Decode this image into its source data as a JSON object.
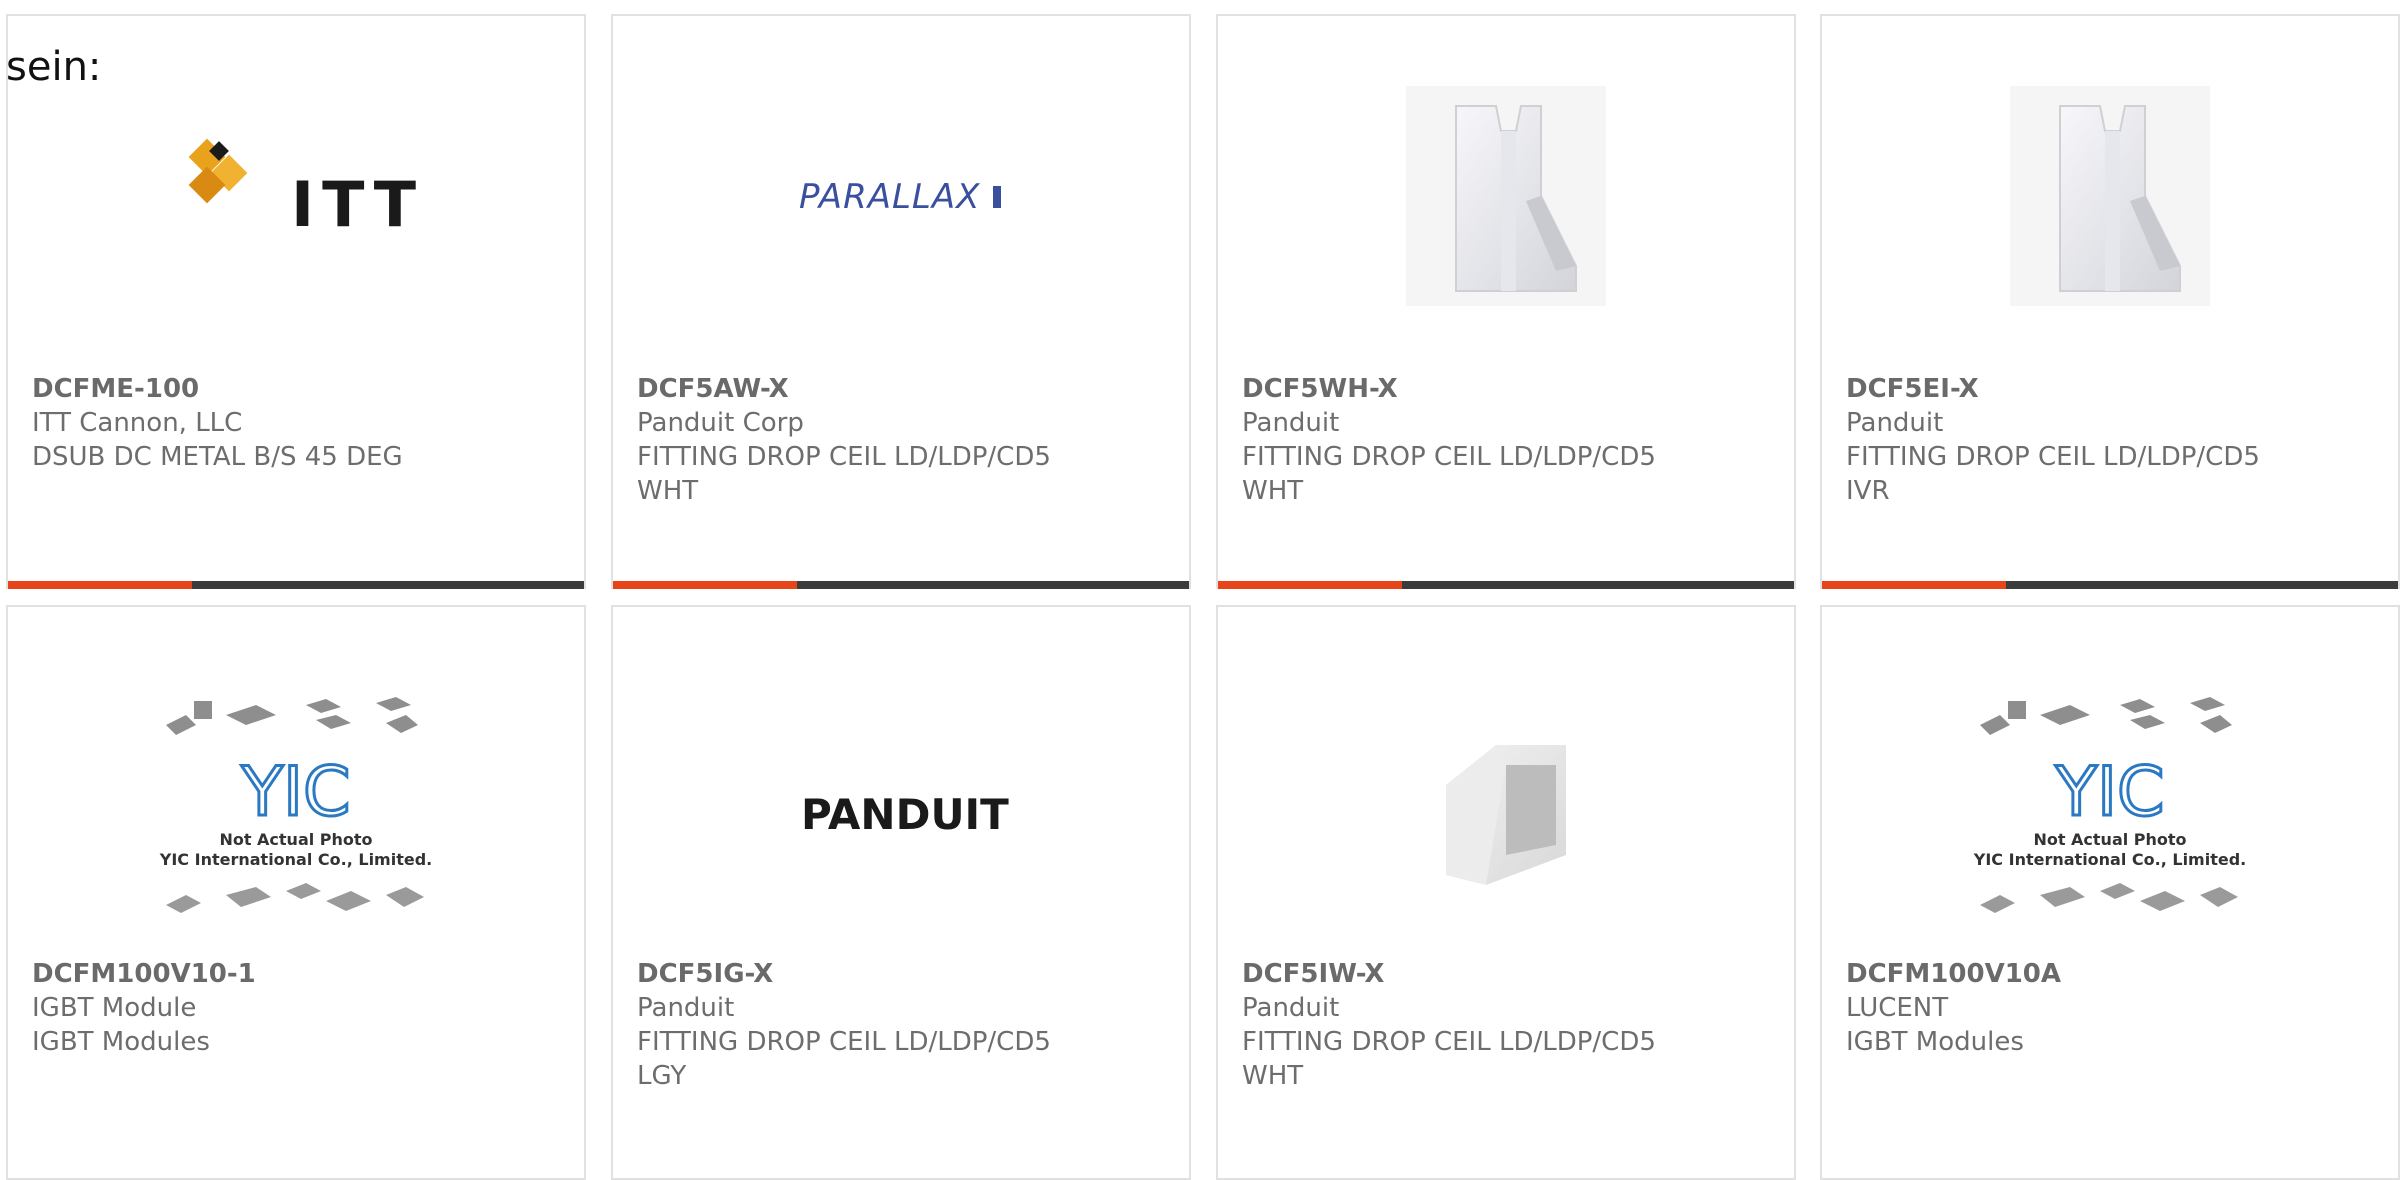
{
  "intro": "sein:",
  "accent_color": "#e8441a",
  "products": [
    {
      "part": "DCFME-100",
      "maker": "ITT Cannon, LLC",
      "desc1": "DSUB DC METAL B/S 45 DEG",
      "desc2": "",
      "image": "itt-logo"
    },
    {
      "part": "DCF5AW-X",
      "maker": "Panduit Corp",
      "desc1": "FITTING DROP CEIL LD/LDP/CD5",
      "desc2": "WHT",
      "image": "parallax-logo"
    },
    {
      "part": "DCF5WH-X",
      "maker": "Panduit",
      "desc1": "FITTING DROP CEIL LD/LDP/CD5",
      "desc2": "WHT",
      "image": "fitting-photo"
    },
    {
      "part": "DCF5EI-X",
      "maker": "Panduit",
      "desc1": "FITTING DROP CEIL LD/LDP/CD5",
      "desc2": "IVR",
      "image": "fitting-photo"
    },
    {
      "part": "DCFM100V10-1",
      "maker": "IGBT Module",
      "desc1": "IGBT Modules",
      "desc2": "",
      "image": "yic-placeholder"
    },
    {
      "part": "DCF5IG-X",
      "maker": "Panduit",
      "desc1": "FITTING DROP CEIL LD/LDP/CD5",
      "desc2": "LGY",
      "image": "panduit-logo"
    },
    {
      "part": "DCF5IW-X",
      "maker": "Panduit",
      "desc1": "FITTING DROP CEIL LD/LDP/CD5",
      "desc2": "WHT",
      "image": "fitting-photo-2"
    },
    {
      "part": "DCFM100V10A",
      "maker": "LUCENT",
      "desc1": "IGBT Modules",
      "desc2": "",
      "image": "yic-placeholder"
    }
  ],
  "logos": {
    "itt": "ITT",
    "parallax": "PARALLAX",
    "panduit": "PANDUIT",
    "yic_line1": "Not Actual Photo",
    "yic_line2": "YIC International Co., Limited.",
    "yic_mark": "YIC"
  }
}
